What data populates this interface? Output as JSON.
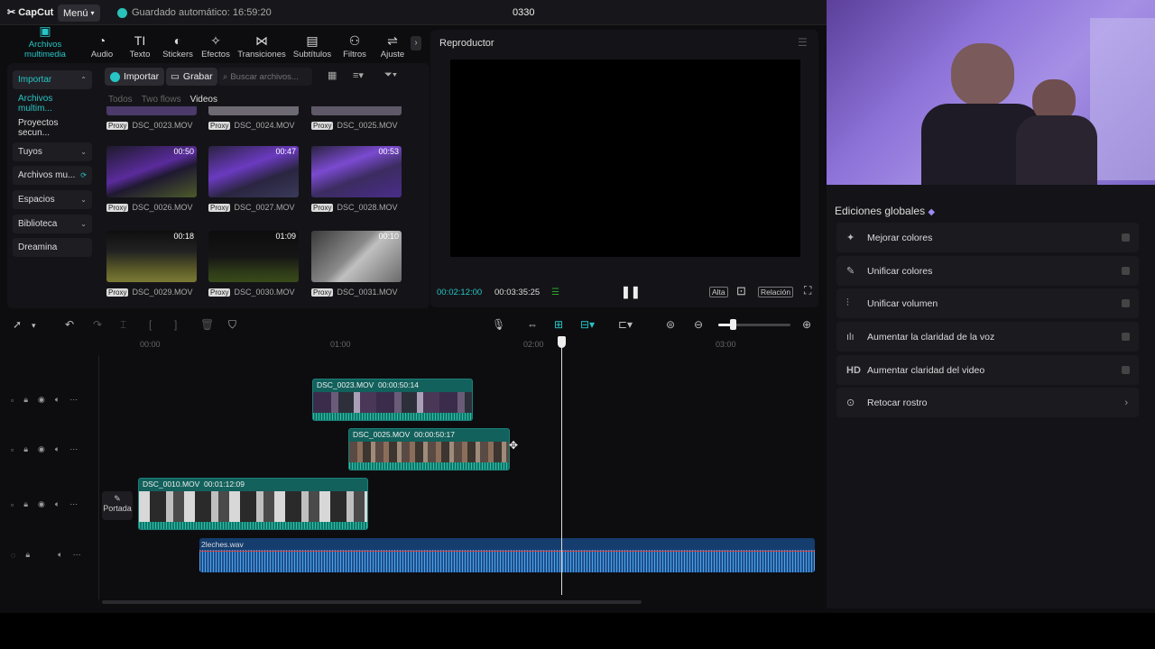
{
  "topbar": {
    "logo": "CapCut",
    "menu_label": "Menú",
    "autosave": "Guardado automático: 16:59:20",
    "project_title": "0330"
  },
  "media_tools": [
    {
      "icon": "media-icon",
      "label": "Archivos multimedia"
    },
    {
      "icon": "audio-icon",
      "label": "Audio"
    },
    {
      "icon": "text-icon",
      "label": "Texto"
    },
    {
      "icon": "stickers-icon",
      "label": "Stickers"
    },
    {
      "icon": "effects-icon",
      "label": "Efectos"
    },
    {
      "icon": "transitions-icon",
      "label": "Transiciones"
    },
    {
      "icon": "subtitles-icon",
      "label": "Subtítulos"
    },
    {
      "icon": "filters-icon",
      "label": "Filtros"
    },
    {
      "icon": "adjust-icon",
      "label": "Ajuste"
    }
  ],
  "side_nav": [
    "Importar",
    "Archivos multim...",
    "Proyectos secun...",
    "Tuyos",
    "Archivos mu...",
    "Espacios",
    "Biblioteca",
    "Dreamina"
  ],
  "media": {
    "import_label": "Importar",
    "record_label": "Grabar",
    "search_placeholder": "Buscar archivos...",
    "filters": [
      "Todos",
      "Two flows",
      "Videos"
    ],
    "proxy_tag": "Proxy",
    "items": [
      {
        "name": "DSC_0023.MOV",
        "duration": ""
      },
      {
        "name": "DSC_0024.MOV",
        "duration": ""
      },
      {
        "name": "DSC_0025.MOV",
        "duration": ""
      },
      {
        "name": "DSC_0026.MOV",
        "duration": "00:50"
      },
      {
        "name": "DSC_0027.MOV",
        "duration": "00:47"
      },
      {
        "name": "DSC_0028.MOV",
        "duration": "00:53"
      },
      {
        "name": "DSC_0029.MOV",
        "duration": "00:18"
      },
      {
        "name": "DSC_0030.MOV",
        "duration": "01:09"
      },
      {
        "name": "DSC_0031.MOV",
        "duration": "00:10"
      }
    ]
  },
  "player": {
    "title": "Reproductor",
    "current_time": "00:02:12:00",
    "total_time": "00:03:35:25",
    "quality": "Alta",
    "ratio": "Relación"
  },
  "timeline": {
    "ruler": [
      "00:00",
      "01:00",
      "02:00",
      "03:00"
    ],
    "cover_label": "Portada",
    "clips": [
      {
        "name": "DSC_0023.MOV",
        "duration": "00:00:50:14"
      },
      {
        "name": "DSC_0025.MOV",
        "duration": "00:00:50:17"
      },
      {
        "name": "DSC_0010.MOV",
        "duration": "00:01:12:09"
      }
    ],
    "audio_clip": "2leches.wav"
  },
  "global": {
    "title": "Ediciones globales",
    "features": [
      {
        "icon": "magic-wand-icon",
        "label": "Mejorar colores"
      },
      {
        "icon": "palette-icon",
        "label": "Unificar colores"
      },
      {
        "icon": "sliders-icon",
        "label": "Unificar volumen"
      },
      {
        "icon": "voice-icon",
        "label": "Aumentar la claridad de la voz"
      },
      {
        "icon": "hd-icon",
        "label": "Aumentar claridad del video"
      },
      {
        "icon": "face-retouch-icon",
        "label": "Retocar rostro"
      }
    ]
  },
  "colors": {
    "accent": "#27c5c5",
    "video_clip": "#12615c",
    "audio_clip": "#153d6e"
  }
}
